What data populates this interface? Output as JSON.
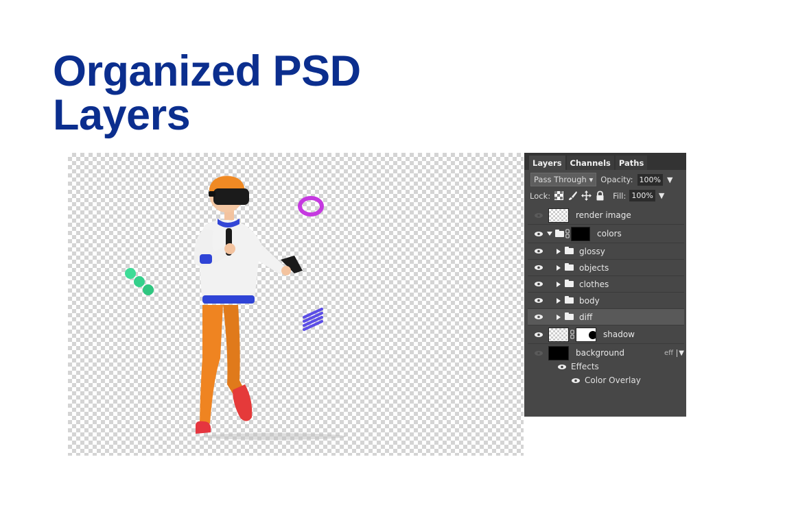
{
  "headline": {
    "line1": "Organized PSD",
    "line2": "Layers"
  },
  "panel": {
    "tabs": [
      "Layers",
      "Channels",
      "Paths"
    ],
    "blend_mode": "Pass Through",
    "opacity_label": "Opacity:",
    "opacity_value": "100%",
    "lock_label": "Lock:",
    "fill_label": "Fill:",
    "fill_value": "100%",
    "layers": {
      "render_image": "render image",
      "colors": "colors",
      "glossy": "glossy",
      "objects": "objects",
      "clothes": "clothes",
      "body": "body",
      "diff": "diff",
      "shadow": "shadow",
      "background": "background"
    },
    "fx_badge": "eff",
    "effects_label": "Effects",
    "color_overlay_label": "Color Overlay"
  },
  "colors": {
    "headline": "#0b2e8e",
    "panel_bg": "#474747",
    "selected_row": "#595959"
  }
}
